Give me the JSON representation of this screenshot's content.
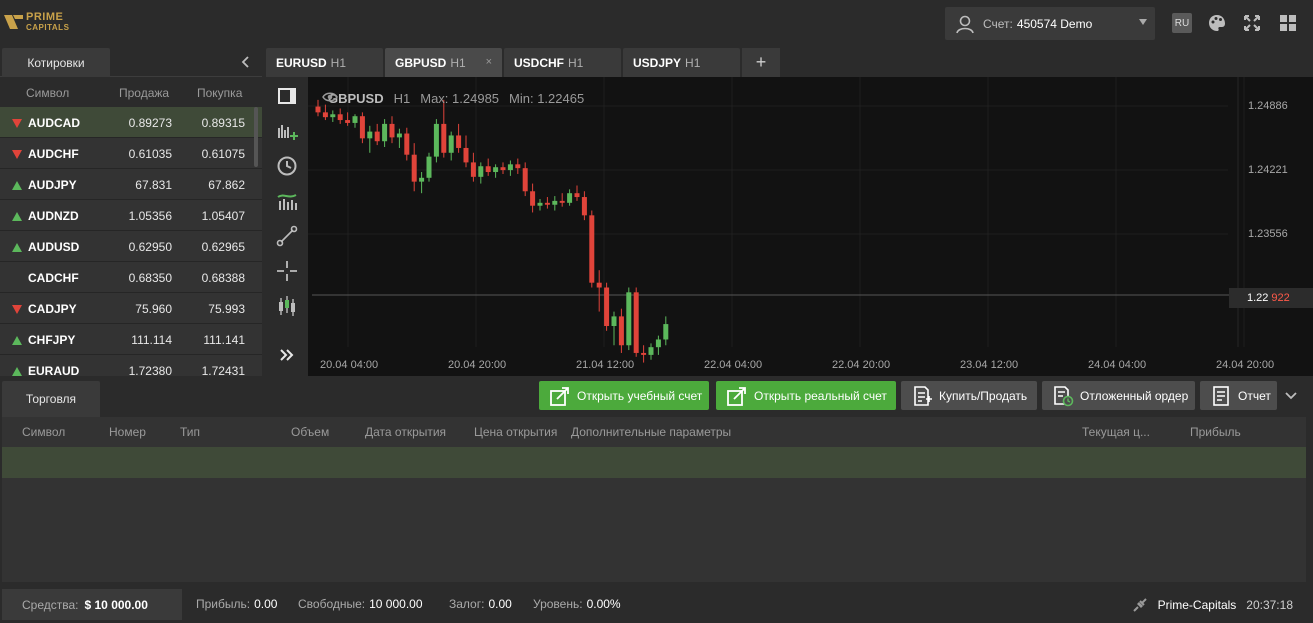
{
  "header": {
    "logo": {
      "line1": "PRIME",
      "line2": "CAPITALS"
    },
    "account": {
      "label": "Счет:",
      "value": "450574 Demo"
    },
    "lang": "RU",
    "icons": [
      "user-icon",
      "palette-icon",
      "fullscreen-icon",
      "layout-grid-icon"
    ]
  },
  "quotes": {
    "tab": "Котировки",
    "columns": [
      "Символ",
      "Продажа",
      "Покупка"
    ],
    "rows": [
      {
        "symbol": "AUDCAD",
        "bid": "0.89273",
        "ask": "0.89315",
        "dir": "down",
        "selected": true
      },
      {
        "symbol": "AUDCHF",
        "bid": "0.61035",
        "ask": "0.61075",
        "dir": "down"
      },
      {
        "symbol": "AUDJPY",
        "bid": "67.831",
        "ask": "67.862",
        "dir": "up"
      },
      {
        "symbol": "AUDNZD",
        "bid": "1.05356",
        "ask": "1.05407",
        "dir": "up"
      },
      {
        "symbol": "AUDUSD",
        "bid": "0.62950",
        "ask": "0.62965",
        "dir": "up"
      },
      {
        "symbol": "CADCHF",
        "bid": "0.68350",
        "ask": "0.68388",
        "dir": "none"
      },
      {
        "symbol": "CADJPY",
        "bid": "75.960",
        "ask": "75.993",
        "dir": "down"
      },
      {
        "symbol": "CHFJPY",
        "bid": "111.114",
        "ask": "111.141",
        "dir": "up"
      },
      {
        "symbol": "EURAUD",
        "bid": "1.72380",
        "ask": "1.72431",
        "dir": "up"
      }
    ],
    "colors": {
      "up": "#5cb85c",
      "down": "#e0443a"
    }
  },
  "chart_tabs": [
    {
      "symbol": "EURUSD",
      "tf": "H1",
      "active": false
    },
    {
      "symbol": "GBPUSD",
      "tf": "H1",
      "active": true,
      "close": "×"
    },
    {
      "symbol": "USDCHF",
      "tf": "H1",
      "active": false
    },
    {
      "symbol": "USDJPY",
      "tf": "H1",
      "active": false
    }
  ],
  "chart_add": "+",
  "tools": [
    "rectangle-icon",
    "indicators-icon",
    "clock-icon",
    "trend-bars-icon",
    "line-tool-icon",
    "crosshair-icon",
    "candles-icon",
    "more-icon"
  ],
  "chart_info": {
    "symbol": "GBPUSD",
    "tf": "H1",
    "max": "Max: 1.24985",
    "min": "Min: 1.22465"
  },
  "price_tag": {
    "main": "1.22",
    "pips": "922"
  },
  "chart_data": {
    "type": "candlestick",
    "symbol": "GBPUSD",
    "timeframe": "H1",
    "y_ticks": [
      "1.24886",
      "1.24221",
      "1.23556"
    ],
    "y_tick_values": [
      1.24886,
      1.24221,
      1.23556
    ],
    "x_ticks": [
      "20.04 04:00",
      "20.04 20:00",
      "21.04 12:00",
      "22.04 04:00",
      "22.04 20:00",
      "23.04 12:00",
      "24.04 04:00",
      "24.04 20:00"
    ],
    "current_price": 1.22922,
    "colors": {
      "bull": "#5cb85c",
      "bear": "#e0443a"
    },
    "candles": [
      [
        1.2488,
        1.2495,
        1.2478,
        1.2482
      ],
      [
        1.2482,
        1.249,
        1.2474,
        1.2477
      ],
      [
        1.2477,
        1.2484,
        1.2472,
        1.248
      ],
      [
        1.248,
        1.2486,
        1.247,
        1.2474
      ],
      [
        1.2474,
        1.2482,
        1.2468,
        1.2471
      ],
      [
        1.2471,
        1.248,
        1.2466,
        1.2478
      ],
      [
        1.2478,
        1.2482,
        1.245,
        1.2455
      ],
      [
        1.2455,
        1.2468,
        1.244,
        1.2462
      ],
      [
        1.2462,
        1.247,
        1.2448,
        1.2452
      ],
      [
        1.2452,
        1.2475,
        1.2446,
        1.247
      ],
      [
        1.247,
        1.2478,
        1.245,
        1.2456
      ],
      [
        1.2456,
        1.2465,
        1.2445,
        1.246
      ],
      [
        1.246,
        1.2466,
        1.2432,
        1.2438
      ],
      [
        1.2438,
        1.245,
        1.24,
        1.241
      ],
      [
        1.241,
        1.242,
        1.2398,
        1.2414
      ],
      [
        1.2414,
        1.244,
        1.241,
        1.2436
      ],
      [
        1.2436,
        1.2475,
        1.243,
        1.247
      ],
      [
        1.247,
        1.2495,
        1.2435,
        1.244
      ],
      [
        1.244,
        1.2462,
        1.2432,
        1.2458
      ],
      [
        1.2458,
        1.247,
        1.244,
        1.2445
      ],
      [
        1.2445,
        1.2458,
        1.2425,
        1.243
      ],
      [
        1.243,
        1.244,
        1.241,
        1.2415
      ],
      [
        1.2415,
        1.243,
        1.2408,
        1.2426
      ],
      [
        1.2426,
        1.2434,
        1.2416,
        1.242
      ],
      [
        1.242,
        1.2428,
        1.2414,
        1.2425
      ],
      [
        1.2425,
        1.243,
        1.2418,
        1.2422
      ],
      [
        1.2422,
        1.2432,
        1.2416,
        1.2428
      ],
      [
        1.2428,
        1.2434,
        1.2418,
        1.2424
      ],
      [
        1.2424,
        1.243,
        1.2395,
        1.24
      ],
      [
        1.24,
        1.2408,
        1.2378,
        1.2385
      ],
      [
        1.2385,
        1.2392,
        1.238,
        1.2388
      ],
      [
        1.2388,
        1.2394,
        1.2382,
        1.2386
      ],
      [
        1.2386,
        1.2395,
        1.238,
        1.239
      ],
      [
        1.239,
        1.2398,
        1.2384,
        1.2388
      ],
      [
        1.2388,
        1.2402,
        1.2385,
        1.2398
      ],
      [
        1.2398,
        1.2406,
        1.239,
        1.2394
      ],
      [
        1.2394,
        1.24,
        1.237,
        1.2375
      ],
      [
        1.2375,
        1.238,
        1.23,
        1.2305
      ],
      [
        1.2305,
        1.2318,
        1.2275,
        1.23
      ],
      [
        1.23,
        1.2305,
        1.2255,
        1.226
      ],
      [
        1.226,
        1.2275,
        1.224,
        1.227
      ],
      [
        1.227,
        1.2278,
        1.2232,
        1.224
      ],
      [
        1.224,
        1.23,
        1.2235,
        1.2295
      ],
      [
        1.2295,
        1.23,
        1.2228,
        1.2232
      ],
      [
        1.2232,
        1.224,
        1.2222,
        1.223
      ],
      [
        1.223,
        1.2242,
        1.2225,
        1.2238
      ],
      [
        1.2238,
        1.225,
        1.223,
        1.2246
      ],
      [
        1.2246,
        1.227,
        1.224,
        1.2262
      ]
    ]
  },
  "trading": {
    "tab": "Торговля",
    "buttons": [
      {
        "label": "Открыть учебный счет",
        "style": "green",
        "icon": "open-account-icon"
      },
      {
        "label": "Открыть реальный счет",
        "style": "green",
        "icon": "open-account-icon"
      },
      {
        "label": "Купить/Продать",
        "style": "gray",
        "icon": "order-icon"
      },
      {
        "label": "Отложенный ордер",
        "style": "gray",
        "icon": "pending-order-icon"
      },
      {
        "label": "Отчет",
        "style": "gray",
        "icon": "report-icon"
      }
    ],
    "columns": [
      "Символ",
      "Номер",
      "Тип",
      "Объем",
      "Дата открытия",
      "Цена открытия",
      "Дополнительные параметры",
      "Текущая ц...",
      "Прибыль"
    ]
  },
  "status": {
    "funds_label": "Средства:",
    "funds_value": "$ 10 000.00",
    "profit_label": "Прибыль:",
    "profit_value": "0.00",
    "free_label": "Свободные:",
    "free_value": "10 000.00",
    "margin_label": "Залог:",
    "margin_value": "0.00",
    "level_label": "Уровень:",
    "level_value": "0.00%",
    "brand": "Prime-Capitals",
    "time": "20:37:18"
  }
}
